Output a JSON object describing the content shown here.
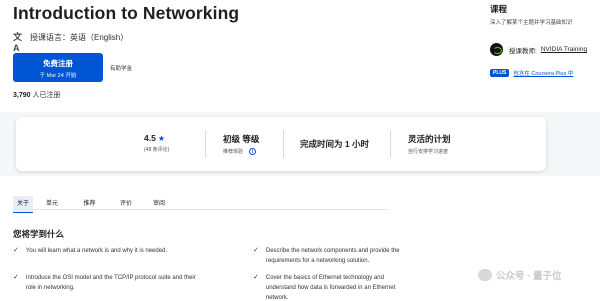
{
  "course": {
    "title": "Introduction to Networking",
    "language": "授课语言：英语（English）",
    "enroll_label": "免费注册",
    "enroll_sub": "于 Mar 24 开始",
    "financial_aid": "有助学金",
    "enrolled_count": "3,790",
    "enrolled_suffix": " 人已注册"
  },
  "sidebar": {
    "title": "课程",
    "subtitle": "深入了解某个主题并学习基础知识",
    "instructor_label": "授课教师:",
    "instructor_name": "NVIDIA Training",
    "plus_badge": "PLUS",
    "plus_text": "包含在 Coursera Plus 中"
  },
  "stats": {
    "rating": "4.5",
    "reviews": "(48 条评论)",
    "level": "初级 等级",
    "level_sub": "推荐体验",
    "duration": "完成时间为 1 小时",
    "schedule": "灵活的计划",
    "schedule_sub": "自行安排学习进度"
  },
  "tabs": [
    {
      "label": "关于"
    },
    {
      "label": "单元"
    },
    {
      "label": "推荐"
    },
    {
      "label": "评价"
    },
    {
      "label": "审阅"
    }
  ],
  "learn": {
    "title": "您将学到什么",
    "items": [
      "You will learn what a network is and why it is needed.",
      "Describe the network components and provide the requirements for a networking solution.",
      "Introduce the OSI model and the TCP/IP protocol suite and their role in networking.",
      "Cover the basics of Ethernet technology and understand how data is forwarded in an Ethernet network."
    ]
  },
  "watermark": {
    "text": "公众号 · 量子位"
  },
  "icons": {
    "translate": "translate-icon",
    "star": "star-icon",
    "info": "info-icon",
    "check": "check-icon"
  },
  "colors": {
    "accent": "#0056d2",
    "nvidia_green": "#76b900"
  }
}
